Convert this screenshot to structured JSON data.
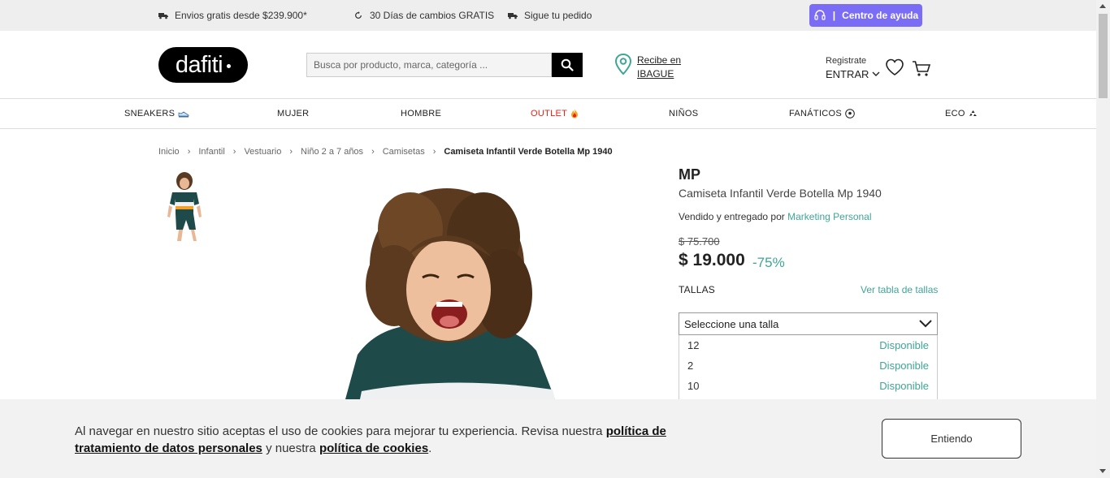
{
  "topbar": {
    "shipping": "Envios gratis desde $239.900*",
    "returns": "30 Días de cambios GRATIS",
    "tracking": "Sigue tu pedido",
    "help": "Centro de ayuda"
  },
  "header": {
    "logo": "dafiti",
    "search_placeholder": "Busca por producto, marca, categoría ...",
    "location_line1": "Recibe en",
    "location_line2": "IBAGUE",
    "register": "Registrate",
    "login": "ENTRAR"
  },
  "nav": [
    {
      "label": "SNEAKERS",
      "icon": "sneaker-icon"
    },
    {
      "label": "MUJER"
    },
    {
      "label": "HOMBRE"
    },
    {
      "label": "OUTLET",
      "icon": "fire-icon"
    },
    {
      "label": "NIÑOS"
    },
    {
      "label": "FANÁTICOS",
      "icon": "soccer-ball-icon"
    },
    {
      "label": "ECO",
      "icon": "recycle-icon"
    }
  ],
  "breadcrumb": [
    "Inicio",
    "Infantil",
    "Vestuario",
    "Niño 2 a 7 años",
    "Camisetas",
    "Camiseta Infantil Verde Botella Mp 1940"
  ],
  "product": {
    "brand": "MP",
    "name": "Camiseta Infantil Verde Botella Mp 1940",
    "sold_by_prefix": "Vendido y entregado por",
    "seller": "Marketing Personal",
    "old_price": "$ 75.700",
    "price": "$ 19.000",
    "discount": "-75%",
    "sizes_label": "TALLAS",
    "size_table_link": "Ver tabla de tallas",
    "size_select_placeholder": "Seleccione una talla",
    "sizes": [
      {
        "size": "12",
        "status": "Disponible"
      },
      {
        "size": "2",
        "status": "Disponible"
      },
      {
        "size": "10",
        "status": "Disponible"
      }
    ]
  },
  "cookie": {
    "text1": "Al navegar en nuestro sitio aceptas el uso de cookies para mejorar tu experiencia. Revisa nuestra ",
    "link1": "política de tratamiento de datos personales",
    "text2": " y nuestra ",
    "link2": "política de cookies",
    "text3": ".",
    "button": "Entiendo"
  },
  "colors": {
    "accent": "#3fa596",
    "help_button": "#7b6cf6",
    "outlet": "#e2231a"
  }
}
